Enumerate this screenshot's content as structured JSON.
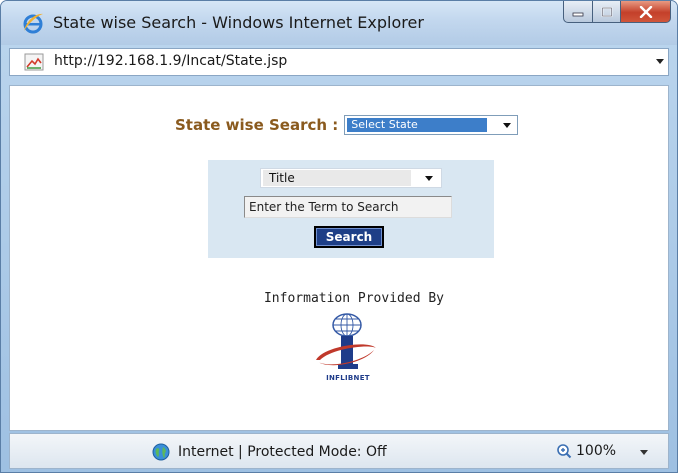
{
  "window": {
    "title": "State wise Search - Windows Internet Explorer",
    "controls": [
      "minimize-icon",
      "maximize-icon",
      "close-icon"
    ]
  },
  "address_bar": {
    "url": "http://192.168.1.9/Incat/State.jsp"
  },
  "main": {
    "state_search_label": "State wise Search :",
    "state_select_value": "Select State",
    "field_select_value": "Title",
    "term_input_value": "Enter the Term to Search",
    "search_button_label": "Search",
    "info_label": "Information Provided By",
    "logo_text": "INFLIBNET"
  },
  "status_bar": {
    "zone_text": "Internet | Protected Mode: Off",
    "zoom_text": "100%"
  },
  "colors": {
    "label_brown": "#8a5a1e",
    "select_highlight": "#3d7ec9",
    "panel_bg": "#d9e7f2",
    "button_bg": "#1e3f87"
  }
}
